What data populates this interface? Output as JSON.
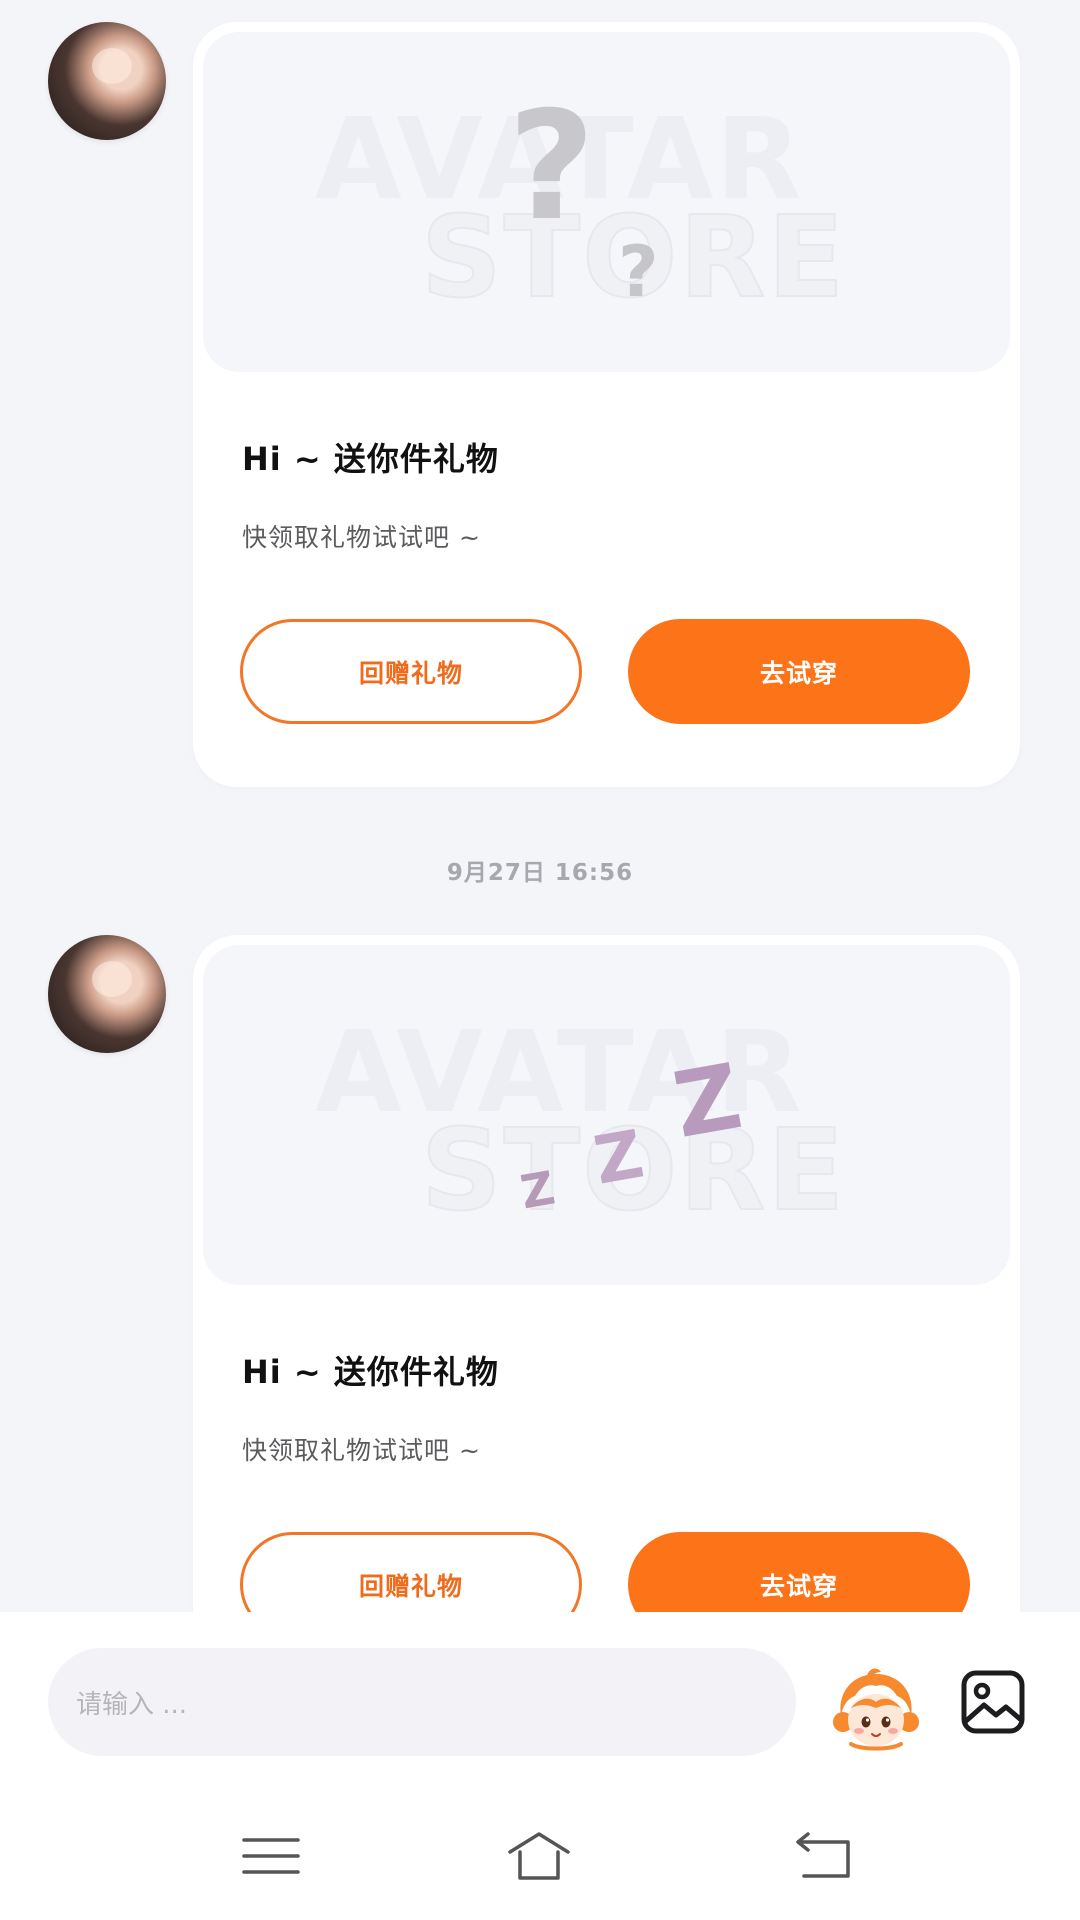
{
  "messages": [
    {
      "image_decoration": "question-marks",
      "watermark_line1": "AVATAR",
      "watermark_line2": "STORE",
      "title": "Hi ~ 送你件礼物",
      "subtitle": "快领取礼物试试吧 ~",
      "return_gift_label": "回赠礼物",
      "try_on_label": "去试穿"
    },
    {
      "image_decoration": "zzz",
      "watermark_line1": "AVATAR",
      "watermark_line2": "STORE",
      "title": "Hi ~ 送你件礼物",
      "subtitle": "快领取礼物试试吧 ~",
      "return_gift_label": "回赠礼物",
      "try_on_label": "去试穿"
    }
  ],
  "timestamp": "9月27日  16:56",
  "input": {
    "placeholder": "请输入 ..."
  },
  "icons": {
    "mascot": "mascot-sticker-icon",
    "image": "image-picker-icon",
    "menu": "menu-icon",
    "home": "home-icon",
    "back": "back-icon"
  },
  "colors": {
    "accent": "#fd7418",
    "background": "#f4f5f9"
  }
}
